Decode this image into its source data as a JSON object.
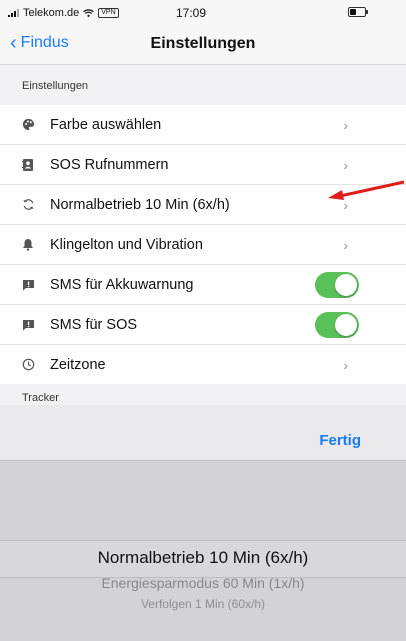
{
  "status_bar": {
    "carrier": "Telekom.de",
    "vpn": "VPN",
    "time": "17:09"
  },
  "nav": {
    "back_label": "Findus",
    "title": "Einstellungen"
  },
  "sections": {
    "settings_header": "Einstellungen",
    "tracker_header": "Tracker"
  },
  "rows": [
    {
      "icon": "palette-icon",
      "label": "Farbe auswählen",
      "accessory": "chevron"
    },
    {
      "icon": "contact-book-icon",
      "label": "SOS Rufnummern",
      "accessory": "chevron"
    },
    {
      "icon": "refresh-icon",
      "label": "Normalbetrieb 10 Min (6x/h)",
      "accessory": "chevron"
    },
    {
      "icon": "bell-icon",
      "label": "Klingelton und Vibration",
      "accessory": "chevron"
    },
    {
      "icon": "alert-message-icon",
      "label": "SMS für Akkuwarnung",
      "accessory": "toggle",
      "on": true
    },
    {
      "icon": "alert-message-icon",
      "label": "SMS für SOS",
      "accessory": "toggle",
      "on": true
    },
    {
      "icon": "clock-icon",
      "label": "Zeitzone",
      "accessory": "chevron"
    }
  ],
  "chevron_glyph": "›",
  "picker": {
    "done_label": "Fertig",
    "options": [
      "Normalbetrieb 10 Min (6x/h)",
      "Energiesparmodus 60 Min (1x/h)",
      "Verfolgen 1 Min (60x/h)"
    ],
    "selected": "Normalbetrieb 10 Min (6x/h)"
  },
  "colors": {
    "accent": "#1a7cf5",
    "toggle_on": "#5ac05a",
    "annotation_arrow": "#e01c1c"
  }
}
